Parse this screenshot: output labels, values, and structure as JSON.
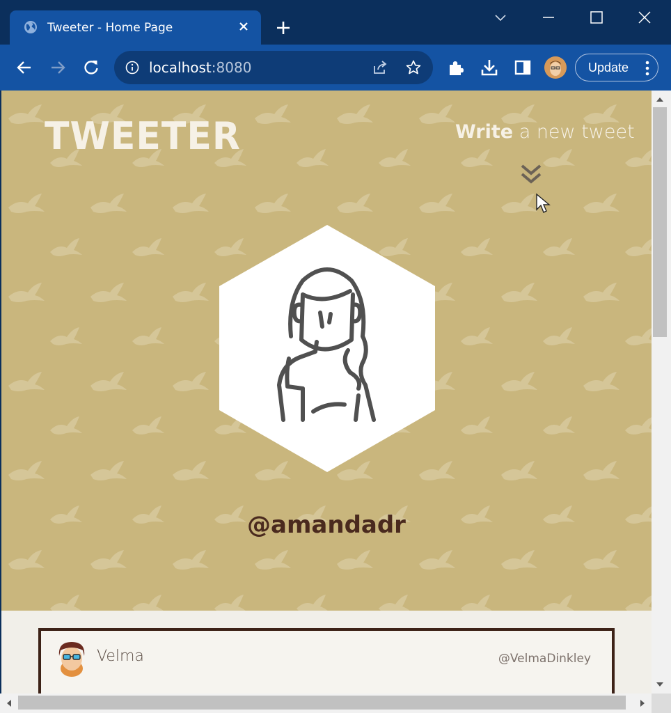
{
  "browser": {
    "tab_title": "Tweeter - Home Page",
    "url_host": "localhost",
    "url_port": ":8080",
    "update_label": "Update"
  },
  "page": {
    "logo": "TWEETER",
    "write_bold": "Write",
    "write_rest": " a new tweet",
    "profile_handle": "@amandadr"
  },
  "tweets": [
    {
      "name": "Velma",
      "handle": "@VelmaDinkley"
    }
  ],
  "colors": {
    "hero_bg": "#c9b67d",
    "accent_dark": "#4a2a1e",
    "chrome_blue": "#1453a3"
  }
}
